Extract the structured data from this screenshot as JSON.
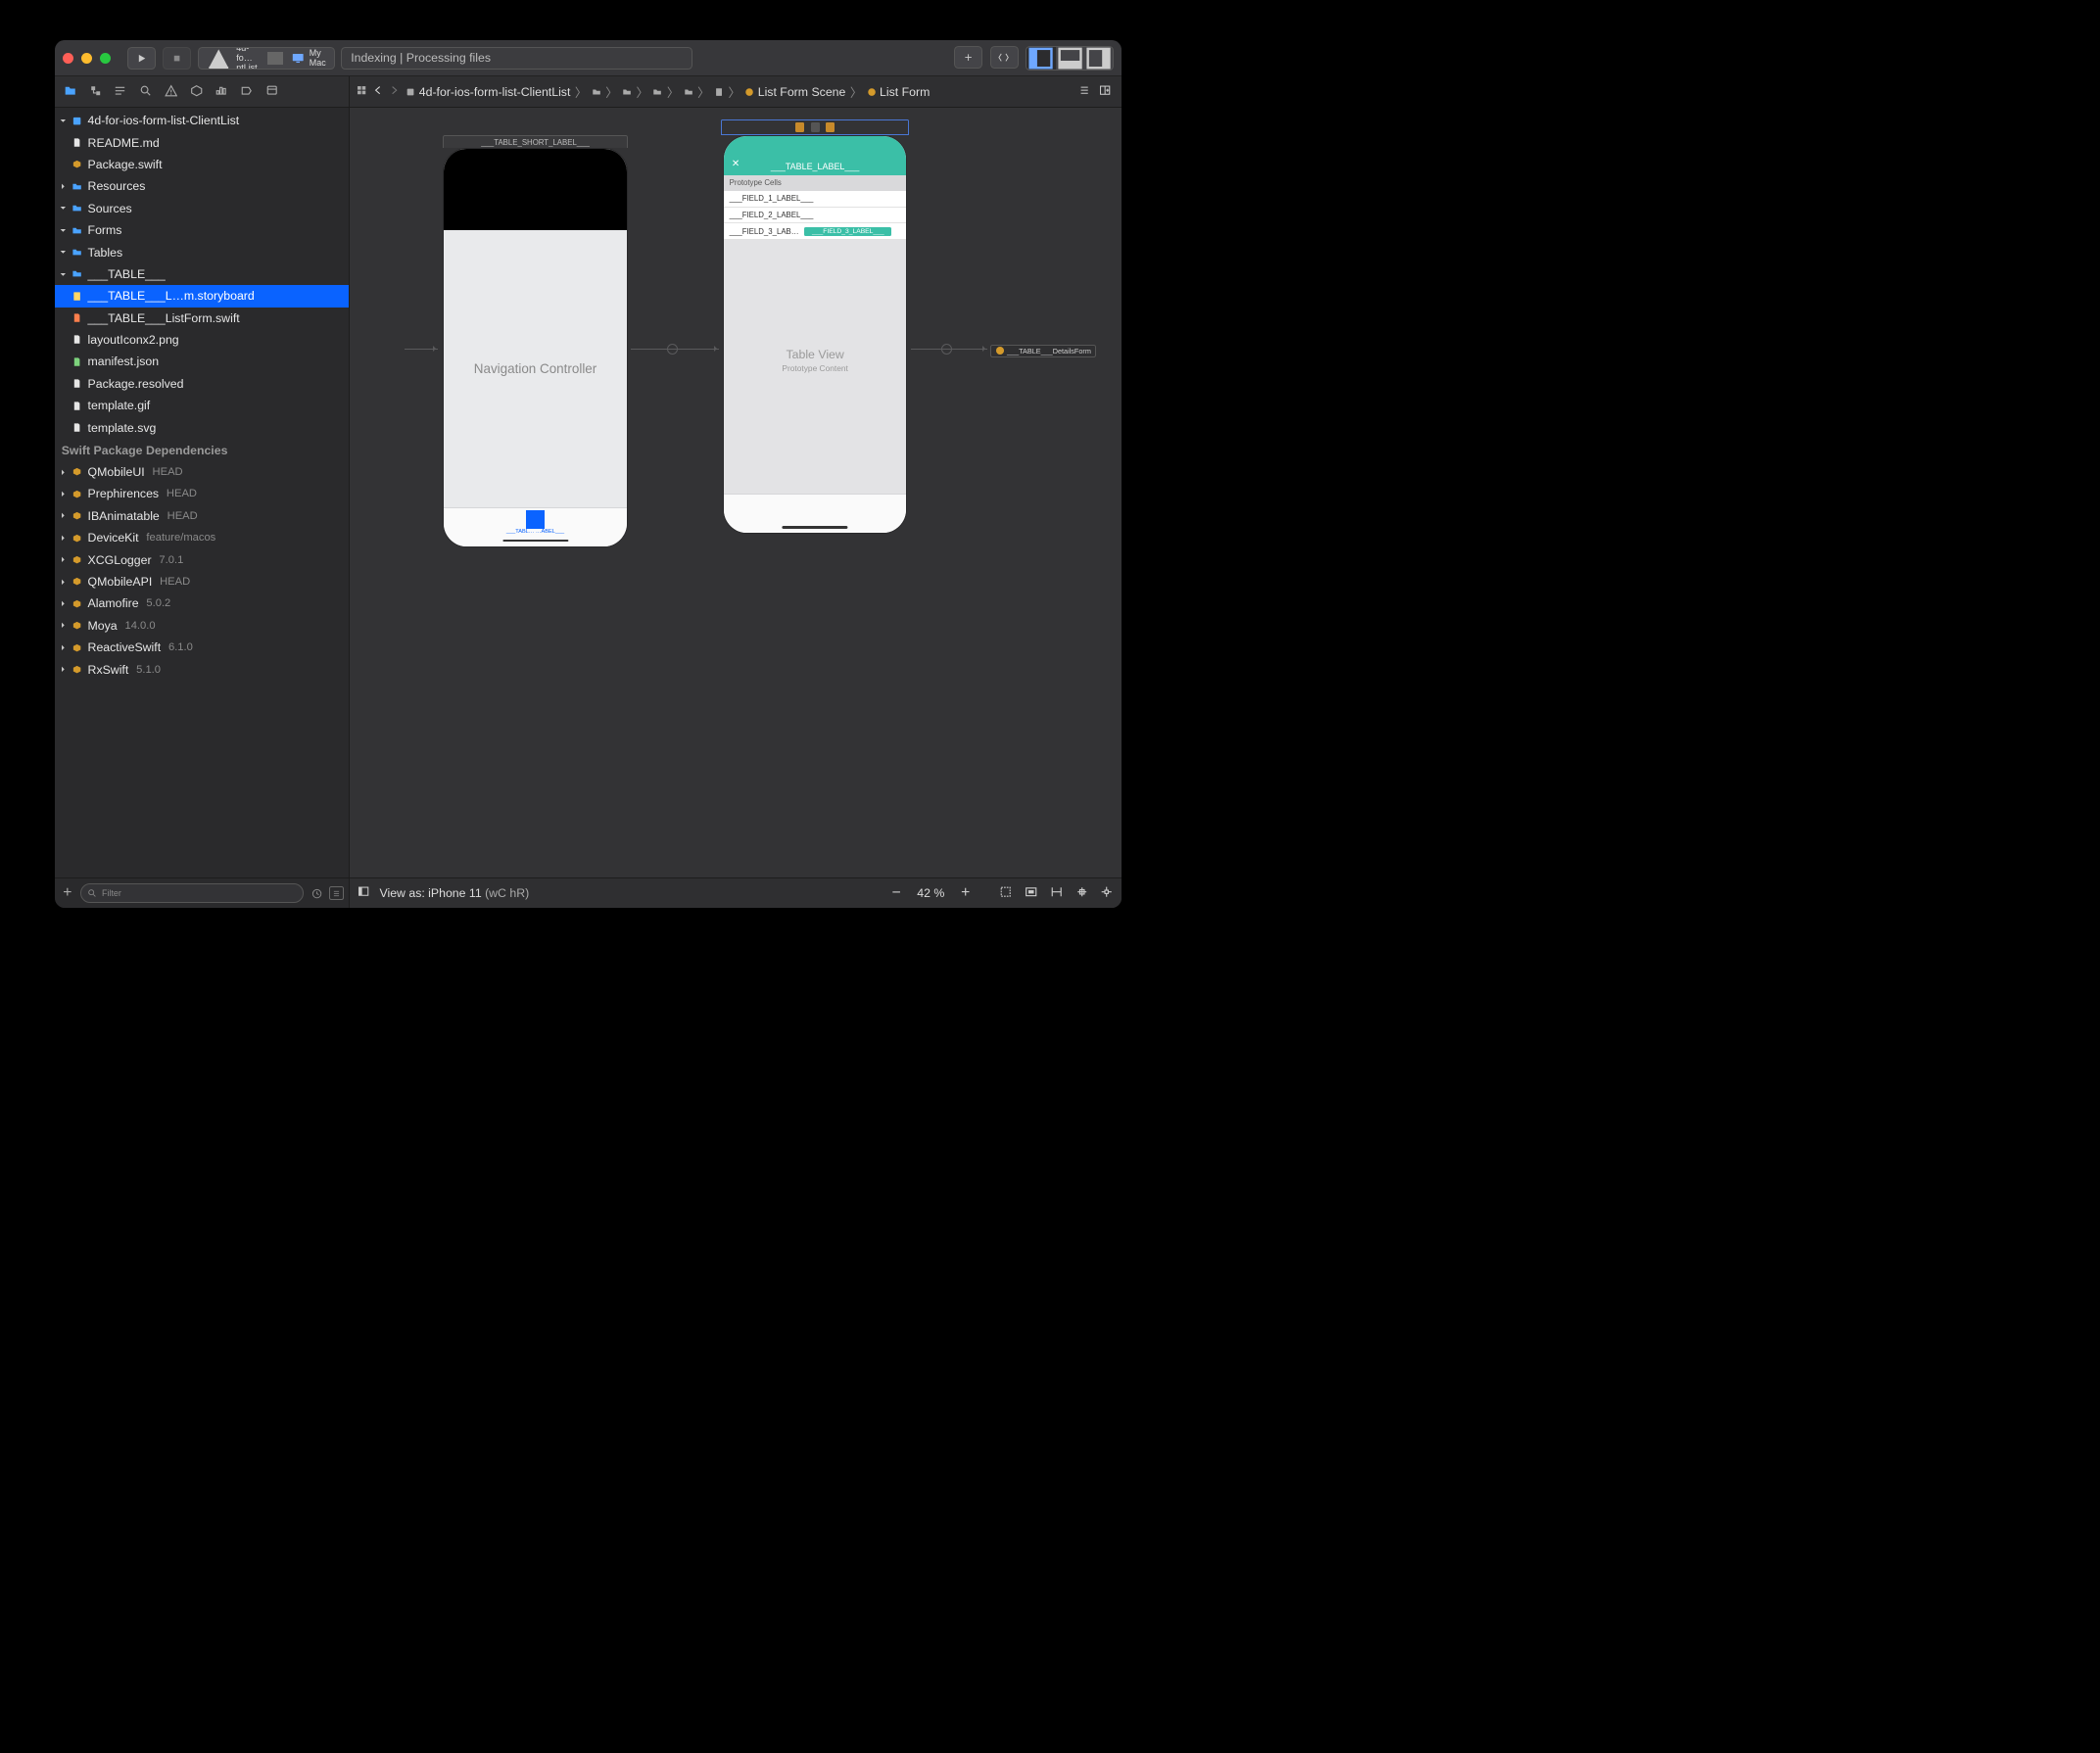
{
  "titlebar": {
    "scheme_name": "4d-fo…ntList",
    "destination": "My Mac",
    "activity": "Indexing | Processing files"
  },
  "jumpbar": {
    "root": "4d-for-ios-form-list-ClientList",
    "scene": "List Form Scene",
    "target": "List Form"
  },
  "tree": {
    "project": "4d-for-ios-form-list-ClientList",
    "readme": "README.md",
    "package_swift": "Package.swift",
    "resources": "Resources",
    "sources": "Sources",
    "forms": "Forms",
    "tables": "Tables",
    "table_group": "___TABLE___",
    "storyboard": "___TABLE___L…m.storyboard",
    "listform_swift": "___TABLE___ListForm.swift",
    "layout_png": "layoutIconx2.png",
    "manifest": "manifest.json",
    "pkg_resolved": "Package.resolved",
    "template_gif": "template.gif",
    "template_svg": "template.svg",
    "deps_header": "Swift Package Dependencies",
    "deps": [
      {
        "name": "QMobileUI",
        "ver": "HEAD"
      },
      {
        "name": "Prephirences",
        "ver": "HEAD"
      },
      {
        "name": "IBAnimatable",
        "ver": "HEAD"
      },
      {
        "name": "DeviceKit",
        "ver": "feature/macos"
      },
      {
        "name": "XCGLogger",
        "ver": "7.0.1"
      },
      {
        "name": "QMobileAPI",
        "ver": "HEAD"
      },
      {
        "name": "Alamofire",
        "ver": "5.0.2"
      },
      {
        "name": "Moya",
        "ver": "14.0.0"
      },
      {
        "name": "ReactiveSwift",
        "ver": "6.1.0"
      },
      {
        "name": "RxSwift",
        "ver": "5.1.0"
      }
    ]
  },
  "filter": {
    "placeholder": "Filter"
  },
  "canvas": {
    "navc_title": "___TABLE_SHORT_LABEL___",
    "navc_body": "Navigation Controller",
    "tab_label": "___TABL…    …ABEL___",
    "tvc_title": "___TABLE_LABEL___",
    "proto_header": "Prototype Cells",
    "field1": "___FIELD_1_LABEL___",
    "field2": "___FIELD_2_LABEL___",
    "field3_left": "___FIELD_3_LAB…",
    "field3_chip": "___FIELD_3_LABEL___",
    "tview_title": "Table View",
    "tview_sub": "Prototype Content",
    "ref_name": "___TABLE___DetailsForm"
  },
  "bottombar": {
    "viewas_prefix": "View as:",
    "viewas_device": "iPhone 11",
    "viewas_traits": "(wC  hR)",
    "zoom": "42 %"
  }
}
